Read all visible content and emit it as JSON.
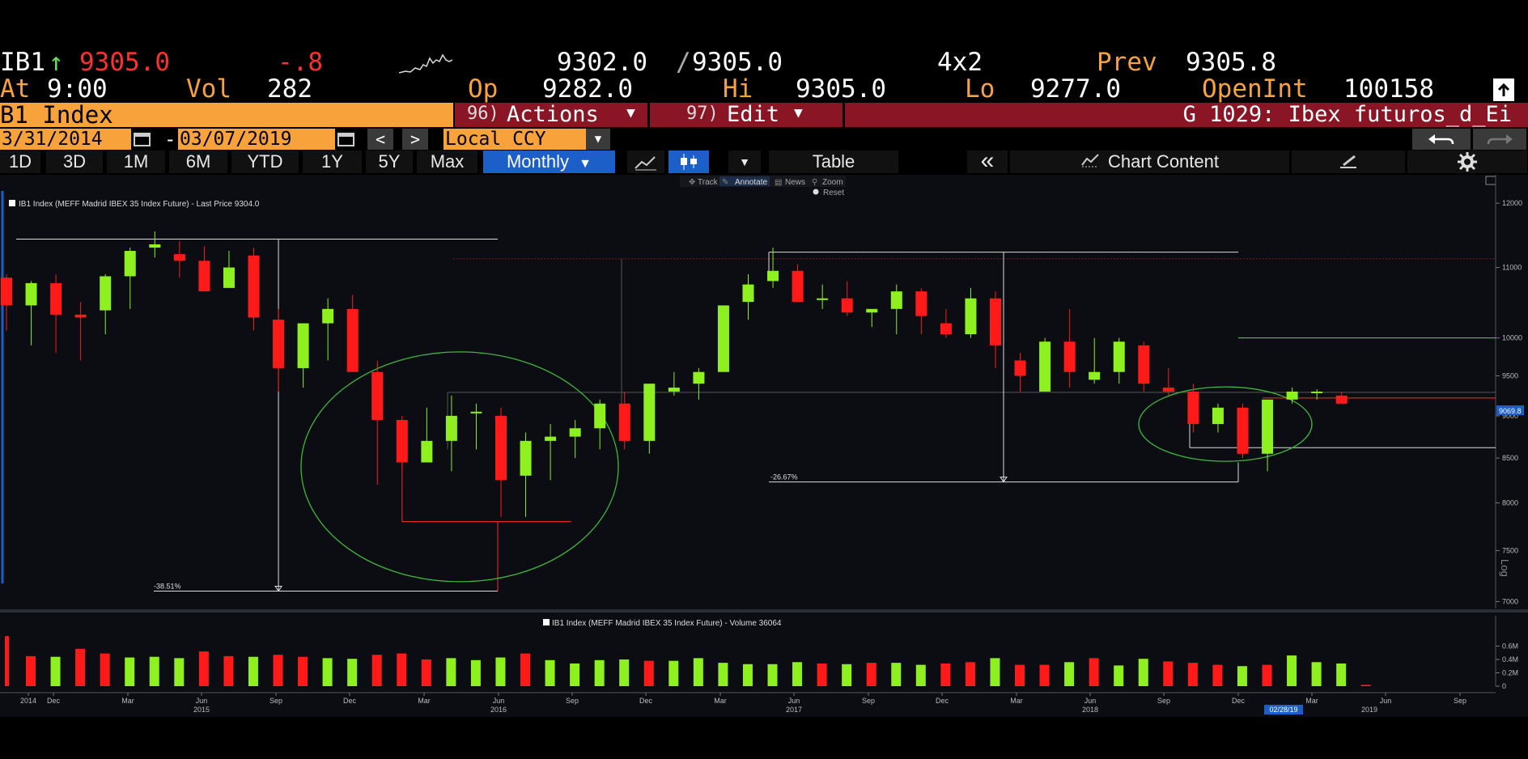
{
  "quote": {
    "ticker": "IB1",
    "arrow": "↑",
    "last": "9305.0",
    "change": "-.8",
    "bid_ask_bid": "9302.0",
    "bid_ask_sep": "/",
    "bid_ask_ask": "9305.0",
    "size": "4x2",
    "prev_label": "Prev",
    "prev_value": "9305.8",
    "at_label": "At",
    "at_time": "9:00",
    "vol_label": "Vol",
    "vol_value": "282",
    "op_label": "Op",
    "op_value": "9282.0",
    "hi_label": "Hi",
    "hi_value": "9305.0",
    "lo_label": "Lo",
    "lo_value": "9277.0",
    "oi_label": "OpenInt",
    "oi_value": "100158"
  },
  "security_bar": {
    "name": "B1 Index",
    "actions_num": "96)",
    "actions_label": "Actions",
    "edit_num": "97)",
    "edit_label": "Edit",
    "page_title": "G 1029: Ibex futuros_d_Ei"
  },
  "date_bar": {
    "start": "3/31/2014",
    "dash": "-",
    "end": "03/07/2019",
    "prev": "<",
    "next": ">",
    "currency": "Local CCY"
  },
  "toolbar": {
    "periods": [
      "1D",
      "3D",
      "1M",
      "6M",
      "YTD",
      "1Y",
      "5Y",
      "Max"
    ],
    "frequency": "Monthly",
    "table": "Table",
    "collapse": "«",
    "chart_content": "Chart Content"
  },
  "chart_tools": {
    "track": "Track",
    "annotate": "Annotate",
    "news": "News",
    "zoom": "Zoom",
    "reset": "Reset"
  },
  "colors": {
    "up": "#8ef01e",
    "down": "#ff1a1a",
    "accent": "#f7a23a",
    "panel_bg": "#0b0d12",
    "selected": "#1c5fc9"
  },
  "chart_data": [
    {
      "type": "candlestick",
      "legend": "IB1 Index (MEFF Madrid IBEX 35 Index Future) - Last Price 9304.0",
      "last_price_tag": "9069.8",
      "y_scale": "log",
      "y_scale_label": "Log",
      "ylim": [
        6950,
        12200
      ],
      "y_ticks": [
        12000,
        11000,
        10000,
        9500,
        9000,
        8500,
        8000,
        7500,
        7000
      ],
      "x_ticks": [
        "2014",
        "Dec",
        "Mar",
        "Jun",
        "Sep",
        "Dec",
        "Mar",
        "Jun",
        "Sep",
        "Dec",
        "Mar",
        "Jun",
        "Sep",
        "Dec",
        "Mar",
        "Jun",
        "Sep",
        "Dec",
        "Mar",
        "Jun",
        "Sep"
      ],
      "x_years": [
        "2015",
        "2016",
        "2017",
        "2018",
        "2019"
      ],
      "x_current_tag": "02/28/19",
      "categories": [
        "2014-09",
        "2014-10",
        "2014-11",
        "2014-12",
        "2015-01",
        "2015-02",
        "2015-03",
        "2015-04",
        "2015-05",
        "2015-06",
        "2015-07",
        "2015-08",
        "2015-09",
        "2015-10",
        "2015-11",
        "2015-12",
        "2016-01",
        "2016-02",
        "2016-03",
        "2016-04",
        "2016-05",
        "2016-06",
        "2016-07",
        "2016-08",
        "2016-09",
        "2016-10",
        "2016-11",
        "2016-12",
        "2017-01",
        "2017-02",
        "2017-03",
        "2017-04",
        "2017-05",
        "2017-06",
        "2017-07",
        "2017-08",
        "2017-09",
        "2017-10",
        "2017-11",
        "2017-12",
        "2018-01",
        "2018-02",
        "2018-03",
        "2018-04",
        "2018-05",
        "2018-06",
        "2018-07",
        "2018-08",
        "2018-09",
        "2018-10",
        "2018-11",
        "2018-12",
        "2019-01",
        "2019-02",
        "2019-03"
      ],
      "ohlc": [
        [
          10850,
          10900,
          10100,
          10450
        ],
        [
          10450,
          10800,
          9900,
          10770
        ],
        [
          10770,
          10900,
          9800,
          10320
        ],
        [
          10320,
          10500,
          9700,
          10280
        ],
        [
          10380,
          10900,
          10050,
          10870
        ],
        [
          10870,
          11300,
          10400,
          11250
        ],
        [
          11300,
          11550,
          11150,
          11350
        ],
        [
          11200,
          11400,
          10850,
          11100
        ],
        [
          11100,
          11320,
          10650,
          10650
        ],
        [
          10700,
          11250,
          10700,
          11000
        ],
        [
          11180,
          11300,
          10100,
          10280
        ],
        [
          10250,
          10400,
          9300,
          9600
        ],
        [
          9600,
          10050,
          9350,
          10200
        ],
        [
          10200,
          10550,
          9700,
          10400
        ],
        [
          10400,
          10600,
          9700,
          9550
        ],
        [
          9550,
          9700,
          8200,
          8950
        ],
        [
          8950,
          9000,
          8350,
          8450
        ],
        [
          8450,
          9100,
          8450,
          8700
        ],
        [
          8700,
          9250,
          8350,
          9000
        ],
        [
          9050,
          9150,
          8600,
          9050
        ],
        [
          9000,
          9100,
          7850,
          8250
        ],
        [
          8300,
          8800,
          7850,
          8700
        ],
        [
          8700,
          8900,
          8250,
          8750
        ],
        [
          8750,
          8950,
          8500,
          8850
        ],
        [
          8850,
          9200,
          8600,
          9150
        ],
        [
          9150,
          9300,
          8600,
          8700
        ],
        [
          8700,
          9400,
          8550,
          9400
        ],
        [
          9300,
          9550,
          9250,
          9350
        ],
        [
          9400,
          9600,
          9200,
          9550
        ],
        [
          9550,
          10350,
          9550,
          10450
        ],
        [
          10500,
          10900,
          10250,
          10750
        ],
        [
          10800,
          11300,
          10700,
          10950
        ],
        [
          10950,
          11050,
          10500,
          10500
        ],
        [
          10550,
          10750,
          10400,
          10550
        ],
        [
          10550,
          10800,
          10300,
          10350
        ],
        [
          10350,
          10400,
          10150,
          10400
        ],
        [
          10400,
          10750,
          10050,
          10650
        ],
        [
          10650,
          10700,
          10050,
          10300
        ],
        [
          10200,
          10400,
          10000,
          10050
        ],
        [
          10050,
          10700,
          10000,
          10550
        ],
        [
          10550,
          10650,
          9600,
          9900
        ],
        [
          9700,
          9800,
          9300,
          9500
        ],
        [
          9300,
          10000,
          9300,
          9950
        ],
        [
          9950,
          10400,
          9350,
          9550
        ],
        [
          9450,
          10000,
          9400,
          9550
        ],
        [
          9550,
          10000,
          9400,
          9950
        ],
        [
          9900,
          9950,
          9300,
          9400
        ],
        [
          9350,
          9600,
          9250,
          9300
        ],
        [
          9300,
          9400,
          8800,
          8900
        ],
        [
          8900,
          9150,
          8800,
          9100
        ],
        [
          9100,
          9150,
          8500,
          8550
        ],
        [
          8550,
          9200,
          8350,
          9200
        ],
        [
          9200,
          9350,
          9150,
          9300
        ],
        [
          9300,
          9330,
          9200,
          9300
        ],
        [
          9250,
          9300,
          9150,
          9150
        ]
      ],
      "annotations": [
        {
          "label": "-38.51%"
        },
        {
          "label": "-26.67%"
        }
      ]
    },
    {
      "type": "bar",
      "legend": "IB1 Index (MEFF Madrid IBEX 35 Index Future) - Volume 36064",
      "ylim": [
        0,
        0.8
      ],
      "y_ticks": [
        "0.6M",
        "0.4M",
        "0.2M",
        "0"
      ],
      "values": [
        0.45,
        0.44,
        0.56,
        0.49,
        0.43,
        0.44,
        0.42,
        0.52,
        0.45,
        0.44,
        0.47,
        0.44,
        0.42,
        0.41,
        0.47,
        0.49,
        0.4,
        0.42,
        0.39,
        0.43,
        0.49,
        0.39,
        0.34,
        0.39,
        0.4,
        0.38,
        0.38,
        0.42,
        0.35,
        0.33,
        0.33,
        0.36,
        0.34,
        0.33,
        0.35,
        0.35,
        0.32,
        0.34,
        0.36,
        0.42,
        0.32,
        0.32,
        0.36,
        0.42,
        0.31,
        0.41,
        0.37,
        0.35,
        0.32,
        0.3,
        0.32,
        0.46,
        0.36,
        0.34,
        0.36
      ]
    }
  ]
}
